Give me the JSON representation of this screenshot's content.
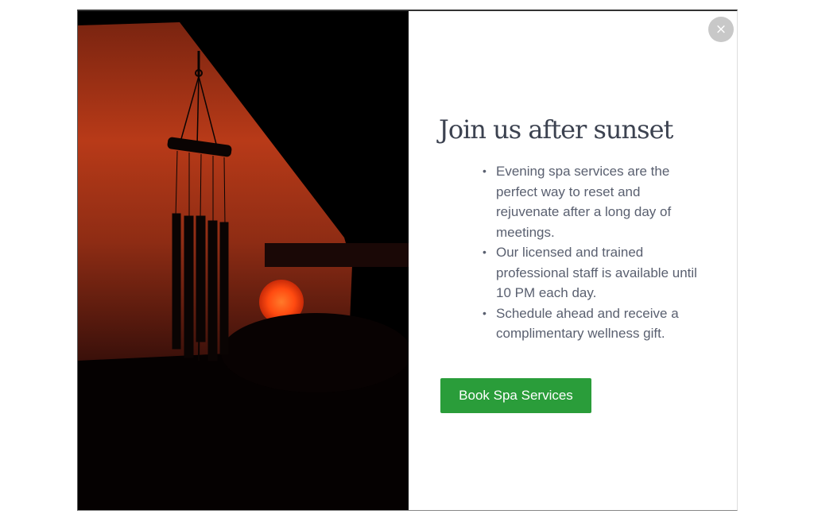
{
  "modal": {
    "close_symbol": "×",
    "close_icon": "close-icon",
    "heading": "Join us after sunset",
    "benefits": [
      "Evening spa services are the perfect way to reset and rejuvenate after a long day of meetings.",
      "Our licensed and trained professional staff is available until 10 PM each day.",
      "Schedule ahead and receive a complimentary wellness gift."
    ],
    "bullet_symbol": "•",
    "cta_label": "Book Spa Services"
  },
  "colors": {
    "cta_background": "#2a9d3a",
    "heading_text": "#3c4250",
    "body_text": "#5a6070",
    "close_background": "#c8c8c8",
    "sky_orange": "#c0401a",
    "sun": "#ff4a10"
  }
}
